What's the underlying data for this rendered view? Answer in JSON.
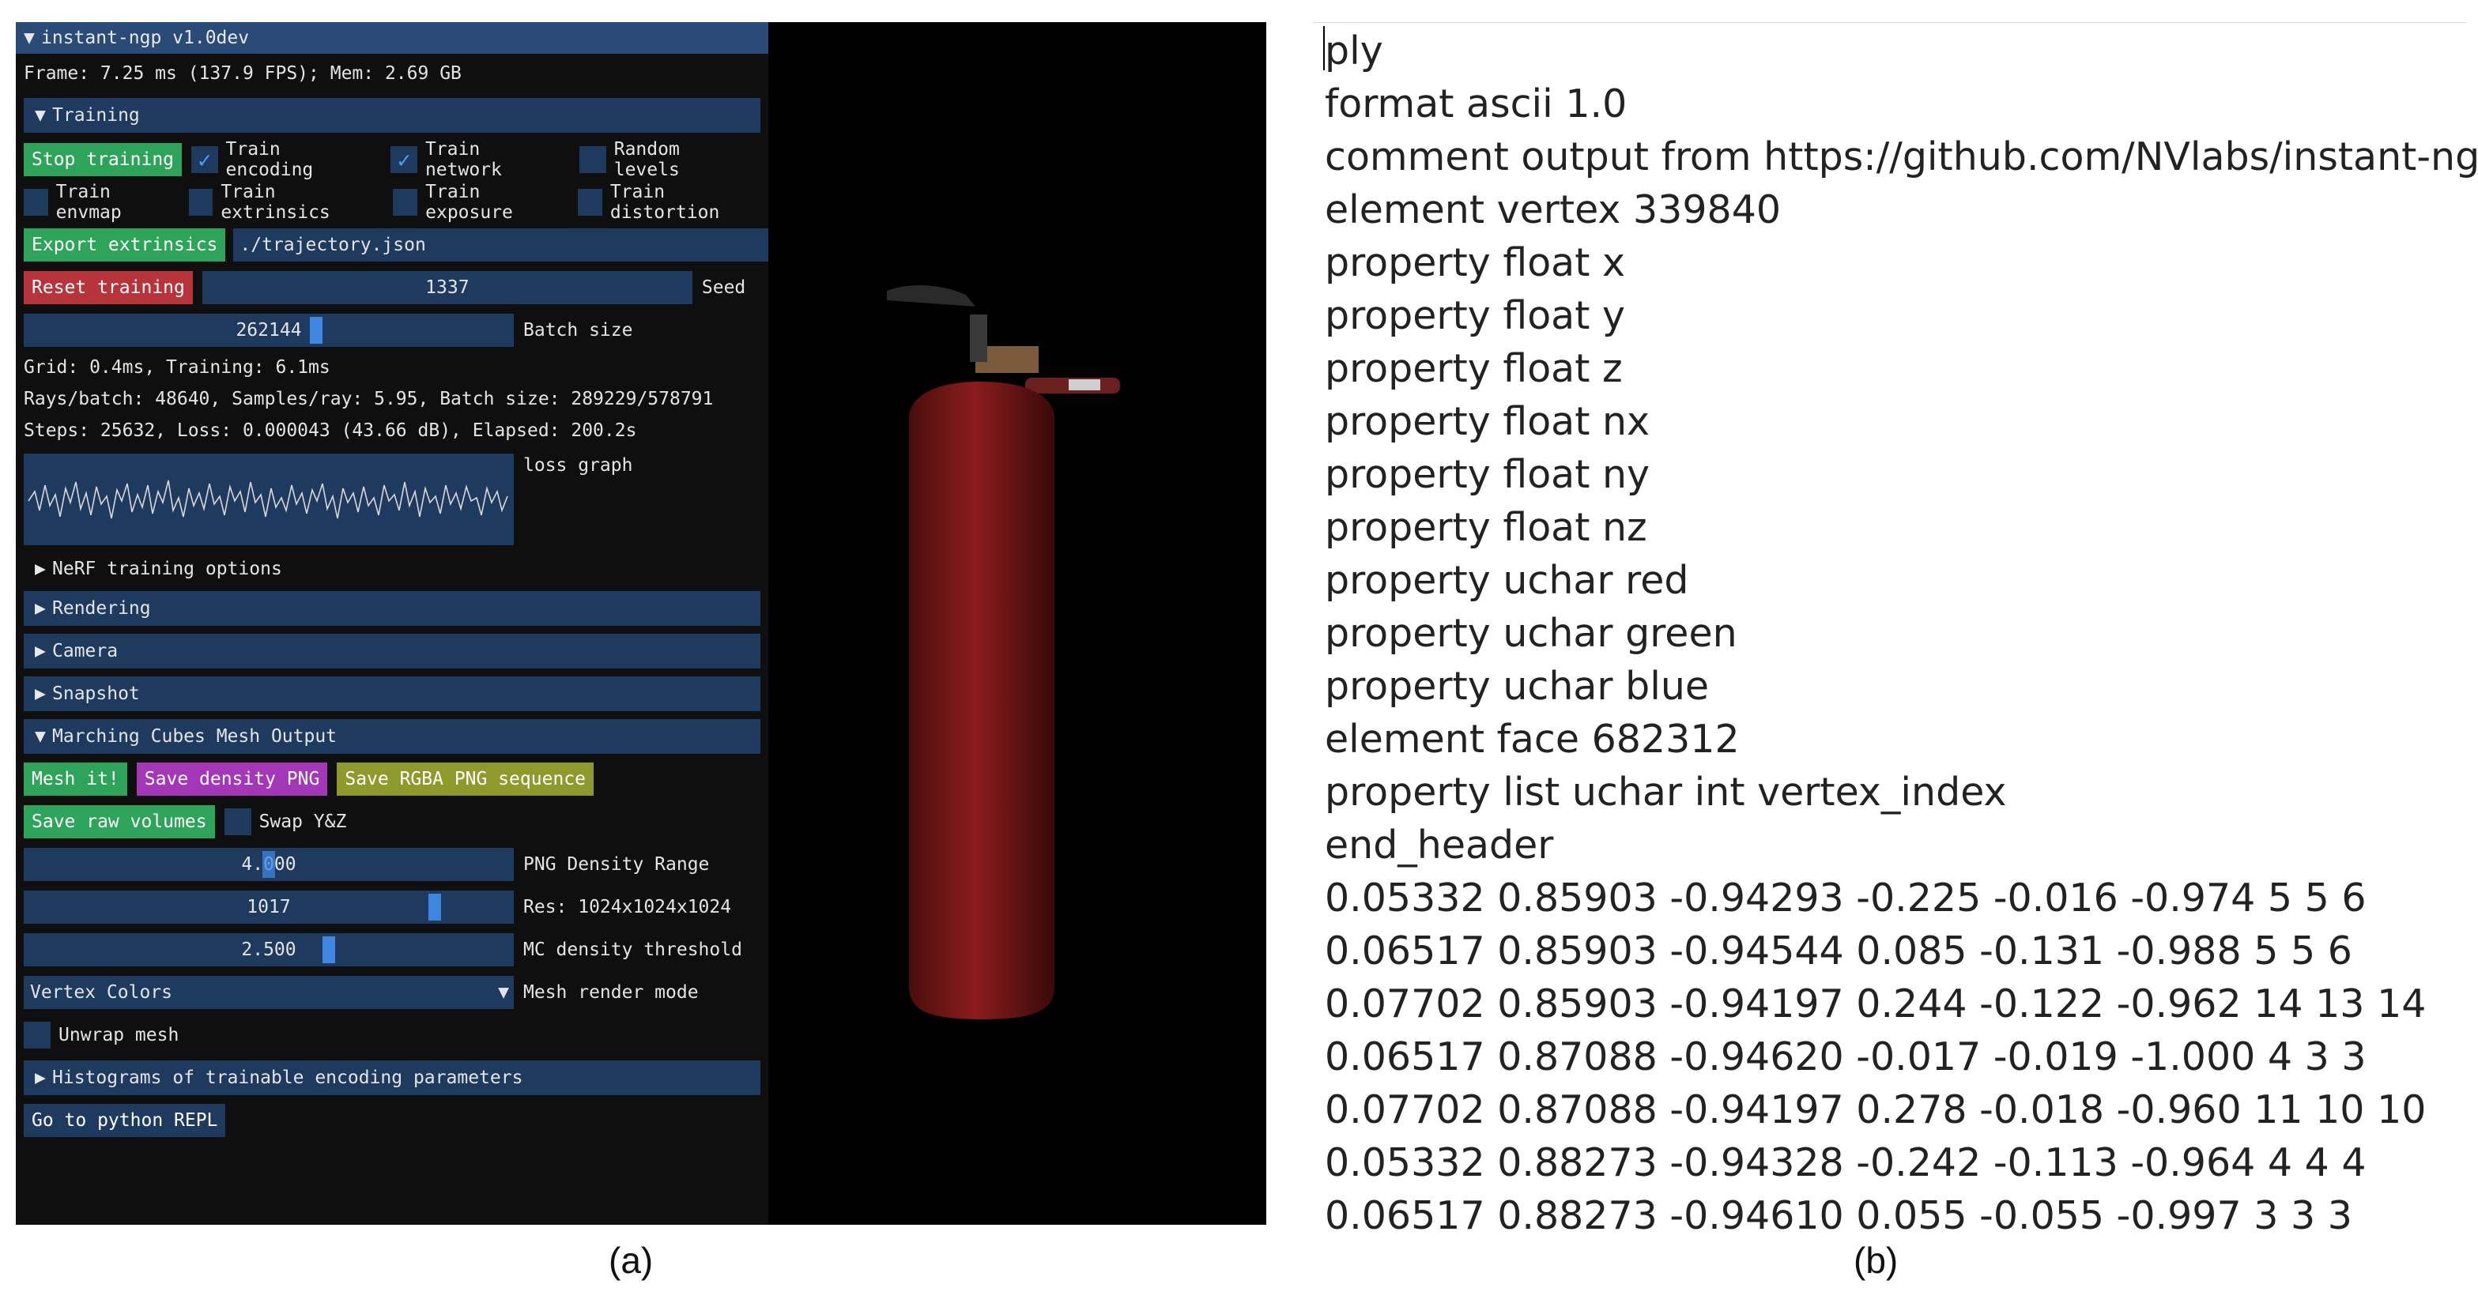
{
  "window_title": "instant-ngp v1.0dev",
  "perf_line": "Frame: 7.25 ms (137.9 FPS); Mem: 2.69 GB",
  "training": {
    "header": "Training",
    "stop_button": "Stop training",
    "train_encoding": {
      "label": "Train encoding",
      "checked": true
    },
    "train_network": {
      "label": "Train network",
      "checked": true
    },
    "random_levels": {
      "label": "Random levels",
      "checked": false
    },
    "train_envmap": {
      "label": "Train envmap",
      "checked": false
    },
    "train_extrinsics": {
      "label": "Train extrinsics",
      "checked": false
    },
    "train_exposure": {
      "label": "Train exposure",
      "checked": false
    },
    "train_distortion": {
      "label": "Train distortion",
      "checked": false
    },
    "export_button": "Export extrinsics",
    "export_path": "./trajectory.json",
    "reset_button": "Reset training",
    "seed_value": "1337",
    "seed_label": "Seed",
    "batch_value": "262144",
    "batch_label": "Batch size",
    "stats_grid": "Grid: 0.4ms, Training: 6.1ms",
    "stats_rays": "Rays/batch: 48640, Samples/ray: 5.95, Batch size: 289229/578791",
    "stats_steps": "Steps: 25632, Loss: 0.000043 (43.66 dB), Elapsed: 200.2s",
    "loss_graph_label": "loss graph",
    "nerf_options": "NeRF training options"
  },
  "sections": {
    "rendering": "Rendering",
    "camera": "Camera",
    "snapshot": "Snapshot",
    "marching": "Marching Cubes Mesh Output",
    "histograms": "Histograms of trainable encoding parameters"
  },
  "mesh": {
    "mesh_button": "Mesh it!",
    "density_button": "Save density PNG",
    "rgba_button": "Save RGBA PNG sequence",
    "raw_button": "Save raw volumes",
    "swap_label": "Swap Y&Z",
    "density_range_value": "4.000",
    "density_range_label": "PNG Density Range",
    "res_value": "1017",
    "res_label": "Res: 1024x1024x1024",
    "threshold_value": "2.500",
    "threshold_label": "MC density threshold",
    "render_mode_value": "Vertex Colors",
    "render_mode_label": "Mesh render mode",
    "unwrap_label": "Unwrap mesh"
  },
  "python_button": "Go to python REPL",
  "ply_lines": [
    "ply",
    "format ascii 1.0",
    "comment output from https://github.com/NVlabs/instant-ngp",
    "element vertex 339840",
    "property float x",
    "property float y",
    "property float z",
    "property float nx",
    "property float ny",
    "property float nz",
    "property uchar red",
    "property uchar green",
    "property uchar blue",
    "element face 682312",
    "property list uchar int vertex_index",
    "end_header",
    "0.05332 0.85903 -0.94293 -0.225 -0.016 -0.974 5 5 6",
    "0.06517 0.85903 -0.94544 0.085 -0.131 -0.988 5 5 6",
    "0.07702 0.85903 -0.94197 0.244 -0.122 -0.962 14 13 14",
    "0.06517 0.87088 -0.94620 -0.017 -0.019 -1.000 4 3 3",
    "0.07702 0.87088 -0.94197 0.278 -0.018 -0.960 11 10 10",
    "0.05332 0.88273 -0.94328 -0.242 -0.113 -0.964 4 4 4",
    "0.06517 0.88273 -0.94610 0.055 -0.055 -0.997 3 3 3"
  ],
  "caption_a": "(a)",
  "caption_b": "(b)",
  "colors": {
    "header_bg": "#1f3a5f",
    "title_bg": "#2a4b78",
    "green_button": "#2ea35a",
    "red_button": "#b7343a",
    "purple_button": "#a436b8",
    "olive_button": "#8f9a2c",
    "slider_handle": "#3f86e0",
    "extinguisher_red": "#8b1c1c"
  }
}
